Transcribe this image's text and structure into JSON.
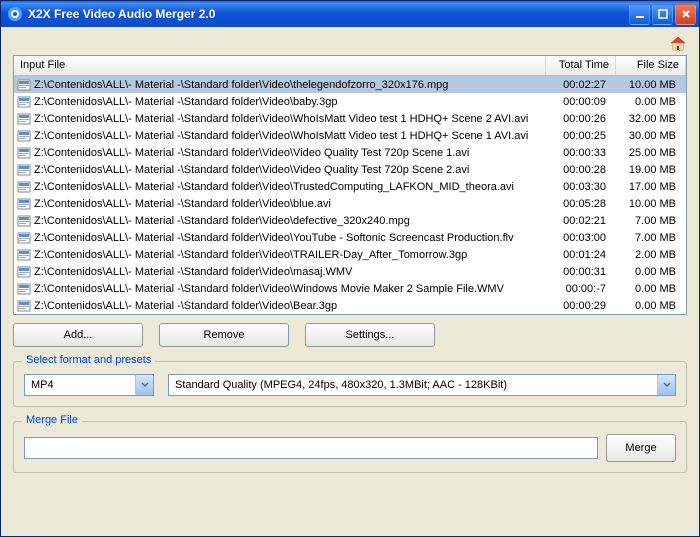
{
  "window": {
    "title": "X2X Free Video Audio Merger 2.0"
  },
  "list": {
    "headers": {
      "file": "Input File",
      "time": "Total Time",
      "size": "File Size"
    },
    "rows": [
      {
        "path": "Z:\\Contenidos\\ALL\\- Material -\\Standard folder\\Video\\thelegendofzorro_320x176.mpg",
        "time": "00:02:27",
        "size": "10.00 MB",
        "selected": true
      },
      {
        "path": "Z:\\Contenidos\\ALL\\- Material -\\Standard folder\\Video\\baby.3gp",
        "time": "00:00:09",
        "size": "0.00 MB"
      },
      {
        "path": "Z:\\Contenidos\\ALL\\- Material -\\Standard folder\\Video\\WhoIsMatt Video test 1 HDHQ+ Scene 2 AVI.avi",
        "time": "00:00:26",
        "size": "32.00 MB"
      },
      {
        "path": "Z:\\Contenidos\\ALL\\- Material -\\Standard folder\\Video\\WhoIsMatt Video test 1 HDHQ+ Scene 1 AVI.avi",
        "time": "00:00:25",
        "size": "30.00 MB"
      },
      {
        "path": "Z:\\Contenidos\\ALL\\- Material -\\Standard folder\\Video\\Video Quality Test 720p Scene 1.avi",
        "time": "00:00:33",
        "size": "25.00 MB"
      },
      {
        "path": "Z:\\Contenidos\\ALL\\- Material -\\Standard folder\\Video\\Video Quality Test 720p Scene 2.avi",
        "time": "00:00:28",
        "size": "19.00 MB"
      },
      {
        "path": "Z:\\Contenidos\\ALL\\- Material -\\Standard folder\\Video\\TrustedComputing_LAFKON_MID_theora.avi",
        "time": "00:03:30",
        "size": "17.00 MB"
      },
      {
        "path": "Z:\\Contenidos\\ALL\\- Material -\\Standard folder\\Video\\blue.avi",
        "time": "00:05:28",
        "size": "10.00 MB"
      },
      {
        "path": "Z:\\Contenidos\\ALL\\- Material -\\Standard folder\\Video\\defective_320x240.mpg",
        "time": "00:02:21",
        "size": "7.00 MB"
      },
      {
        "path": "Z:\\Contenidos\\ALL\\- Material -\\Standard folder\\Video\\YouTube - Softonic Screencast Production.flv",
        "time": "00:03:00",
        "size": "7.00 MB"
      },
      {
        "path": "Z:\\Contenidos\\ALL\\- Material -\\Standard folder\\Video\\TRAILER-Day_After_Tomorrow.3gp",
        "time": "00:01:24",
        "size": "2.00 MB"
      },
      {
        "path": "Z:\\Contenidos\\ALL\\- Material -\\Standard folder\\Video\\masaj.WMV",
        "time": "00:00:31",
        "size": "0.00 MB"
      },
      {
        "path": "Z:\\Contenidos\\ALL\\- Material -\\Standard folder\\Video\\Windows Movie Maker 2 Sample File.WMV",
        "time": "00:00:-7",
        "size": "0.00 MB"
      },
      {
        "path": "Z:\\Contenidos\\ALL\\- Material -\\Standard folder\\Video\\Bear.3gp",
        "time": "00:00:29",
        "size": "0.00 MB"
      }
    ]
  },
  "buttons": {
    "add": "Add...",
    "remove": "Remove",
    "settings": "Settings..."
  },
  "format": {
    "legend": "Select format and presets",
    "type": "MP4",
    "preset": "Standard Quality  (MPEG4,  24fps,  480x320,  1.3MBit;   AAC - 128KBit)"
  },
  "merge": {
    "legend": "Merge File",
    "button": "Merge",
    "output": ""
  }
}
